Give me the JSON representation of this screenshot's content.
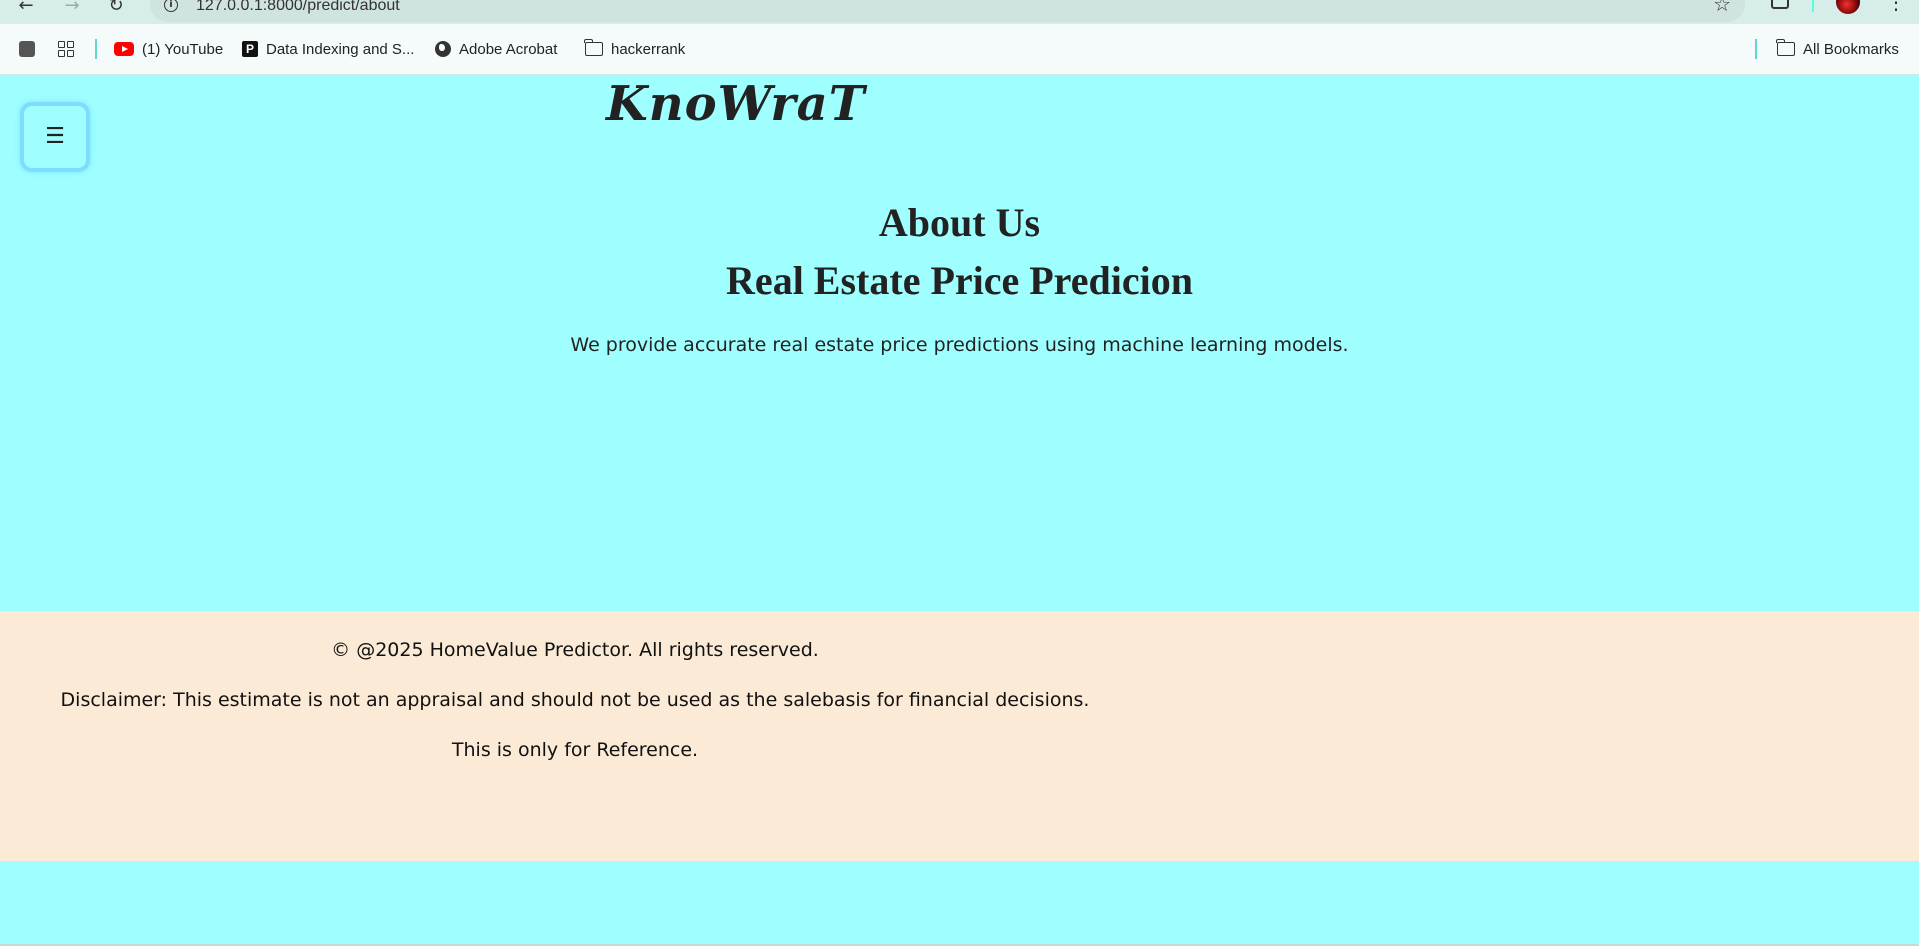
{
  "browser": {
    "url": "127.0.0.1:8000/predict/about",
    "back_icon": "←",
    "forward_icon": "→",
    "reload_icon": "↻",
    "star_icon": "☆",
    "menu_icon": "⋮"
  },
  "bookmarks": {
    "items": [
      {
        "label": "(1) YouTube",
        "icon": "youtube-icon"
      },
      {
        "label": "Data Indexing and S...",
        "icon": "p-icon"
      },
      {
        "label": "Adobe Acrobat",
        "icon": "globe-icon"
      },
      {
        "label": "hackerrank",
        "icon": "folder-icon"
      }
    ],
    "all_bookmarks": "All Bookmarks"
  },
  "page": {
    "menu_icon": "☰",
    "brand": "KnoWraT",
    "title": "About Us",
    "subtitle": "Real Estate Price Predicion",
    "description": "We provide accurate real estate price predictions using machine learning models."
  },
  "footer": {
    "copyright": "© @2025 HomeValue Predictor. All rights reserved.",
    "disclaimer": "Disclaimer: This estimate is not an appraisal and should not be used as the salebasis for financial decisions.",
    "note": "This is only for Reference."
  },
  "colors": {
    "page_background": "#9fffff",
    "footer_background": "#fbead6",
    "menu_button_border": "#7fdcff"
  }
}
